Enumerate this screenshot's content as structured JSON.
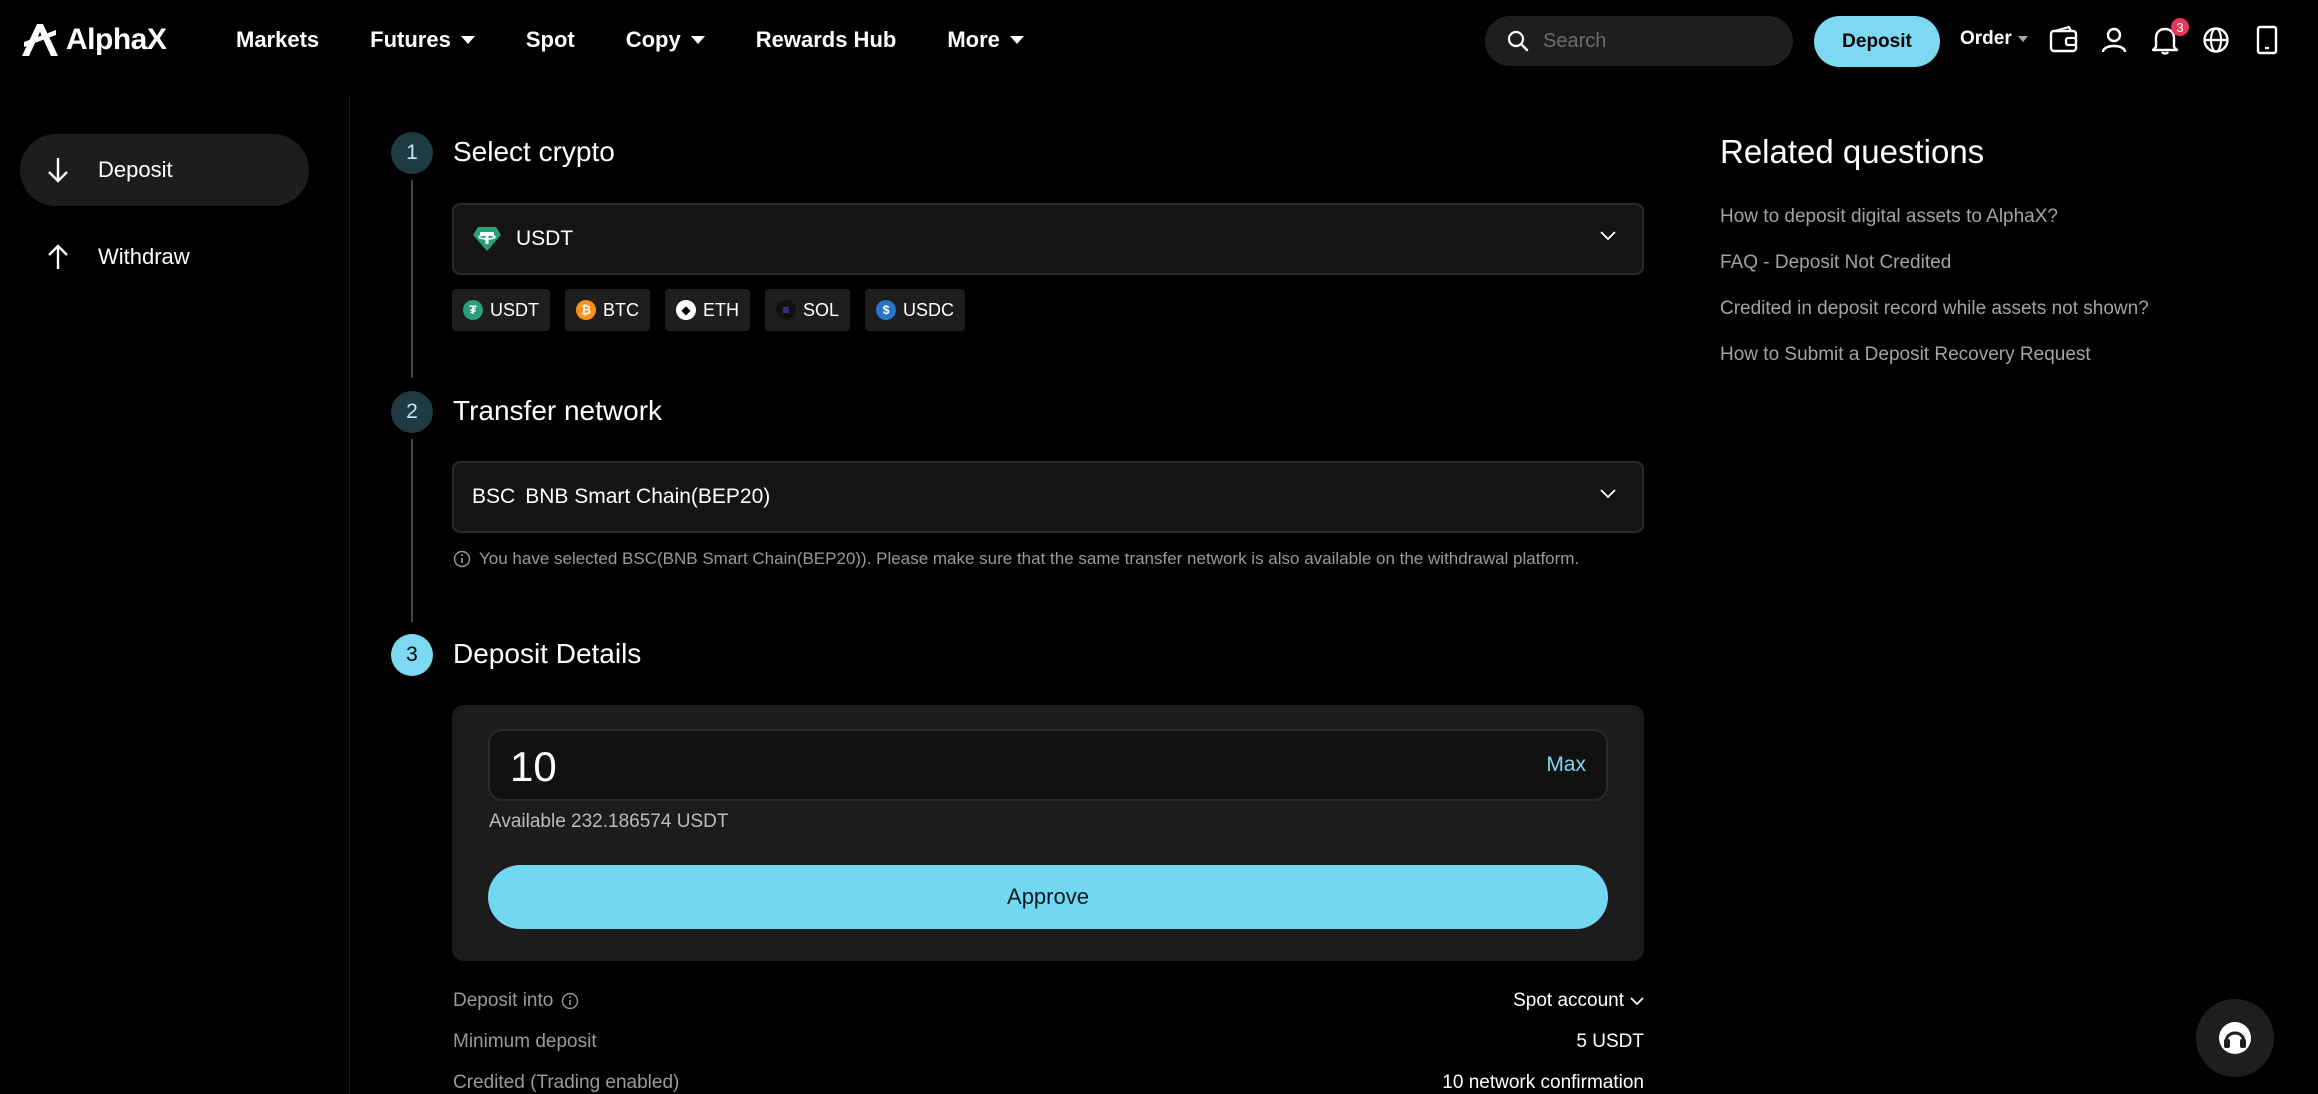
{
  "header": {
    "brand": "AlphaX",
    "nav": [
      {
        "label": "Markets",
        "dropdown": false
      },
      {
        "label": "Futures",
        "dropdown": true
      },
      {
        "label": "Spot",
        "dropdown": false
      },
      {
        "label": "Copy",
        "dropdown": true
      },
      {
        "label": "Rewards Hub",
        "dropdown": false
      },
      {
        "label": "More",
        "dropdown": true
      }
    ],
    "search_placeholder": "Search",
    "deposit_label": "Deposit",
    "order_label": "Order",
    "notification_count": "3",
    "icons": [
      "wallet-icon",
      "user-icon",
      "bell-icon",
      "globe-icon",
      "mobile-icon"
    ]
  },
  "sidebar": {
    "items": [
      {
        "label": "Deposit",
        "icon": "arrow-down-icon",
        "active": true
      },
      {
        "label": "Withdraw",
        "icon": "arrow-up-icon",
        "active": false
      }
    ]
  },
  "steps": [
    {
      "number": "1",
      "title": "Select crypto"
    },
    {
      "number": "2",
      "title": "Transfer network"
    },
    {
      "number": "3",
      "title": "Deposit Details"
    }
  ],
  "crypto": {
    "selected": "USDT",
    "chips": [
      "USDT",
      "BTC",
      "ETH",
      "SOL",
      "USDC"
    ]
  },
  "network": {
    "code": "BSC",
    "name": "BNB Smart Chain(BEP20)",
    "note": "You have selected BSC(BNB Smart Chain(BEP20)). Please make sure that the same transfer network is also available on the withdrawal platform."
  },
  "deposit": {
    "amount": "10",
    "max_label": "Max",
    "available": "Available 232.186574 USDT",
    "approve_label": "Approve"
  },
  "info": [
    {
      "label": "Deposit into",
      "value": "Spot account"
    },
    {
      "label": "Minimum deposit",
      "value": "5 USDT"
    },
    {
      "label": "Credited (Trading enabled)",
      "value": "10 network confirmation"
    }
  ],
  "related": {
    "title": "Related questions",
    "links": [
      "How to deposit digital assets to AlphaX?",
      "FAQ - Deposit Not Credited",
      "Credited in deposit record while assets not shown?",
      "How to Submit a Deposit Recovery Request"
    ]
  },
  "colors": {
    "accent": "#7dd9f2",
    "background": "#000000",
    "badge": "#e8365d"
  }
}
